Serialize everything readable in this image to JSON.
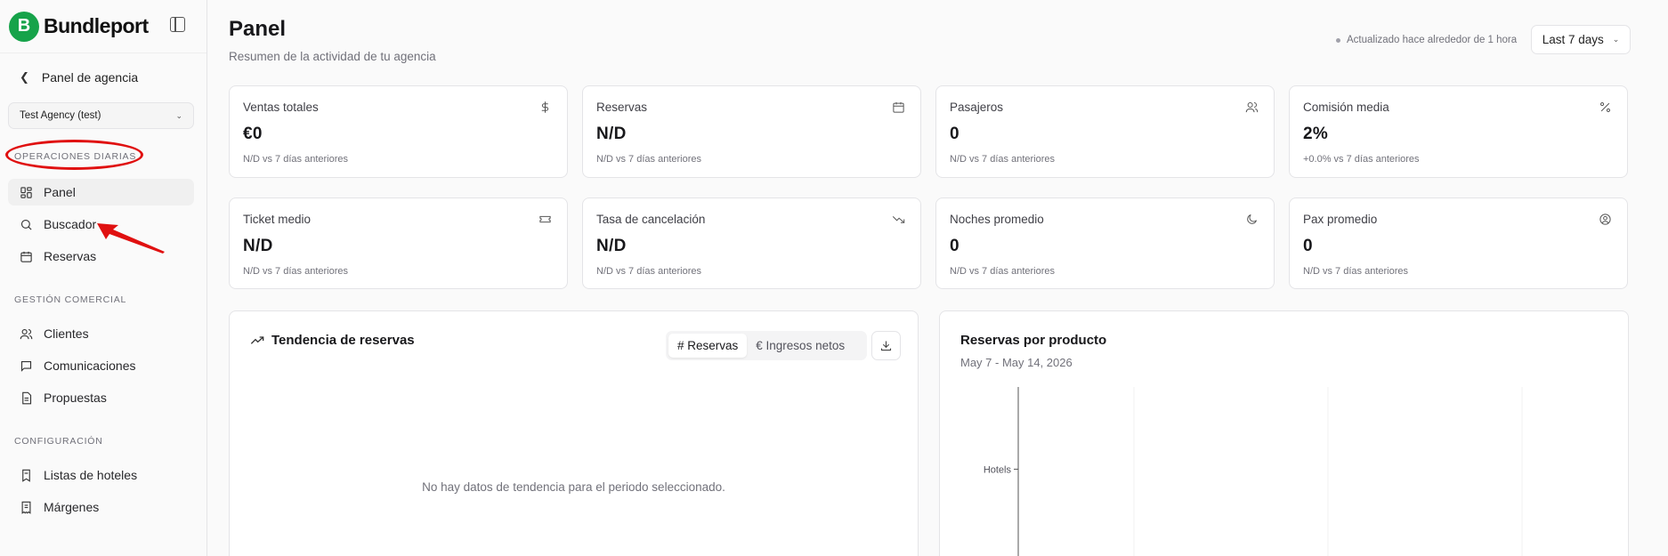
{
  "brand": {
    "name": "Bundleport",
    "mark": "B"
  },
  "sidebar": {
    "back_label": "Panel de agencia",
    "agency_selected": "Test Agency (test)",
    "sections": [
      {
        "title": "OPERACIONES DIARIAS",
        "items": [
          {
            "label": "Panel",
            "icon": "dashboard-icon",
            "active": true
          },
          {
            "label": "Buscador",
            "icon": "search-icon"
          },
          {
            "label": "Reservas",
            "icon": "calendar-icon"
          }
        ]
      },
      {
        "title": "GESTIÓN COMERCIAL",
        "items": [
          {
            "label": "Clientes",
            "icon": "users-icon"
          },
          {
            "label": "Comunicaciones",
            "icon": "message-icon"
          },
          {
            "label": "Propuestas",
            "icon": "document-icon"
          }
        ]
      },
      {
        "title": "CONFIGURACIÓN",
        "items": [
          {
            "label": "Listas de hoteles",
            "icon": "bookmark-list-icon"
          },
          {
            "label": "Márgenes",
            "icon": "receipt-icon"
          }
        ]
      }
    ]
  },
  "header": {
    "title": "Panel",
    "subtitle": "Resumen de la actividad de tu agencia",
    "updated": "Actualizado hace alrededor de 1 hora",
    "range": "Last 7 days"
  },
  "kpis": [
    {
      "label": "Ventas totales",
      "value": "€0",
      "compare": "N/D vs 7 días anteriores",
      "icon": "dollar-icon"
    },
    {
      "label": "Reservas",
      "value": "N/D",
      "compare": "N/D vs 7 días anteriores",
      "icon": "calendar-icon"
    },
    {
      "label": "Pasajeros",
      "value": "0",
      "compare": "N/D vs 7 días anteriores",
      "icon": "users-icon"
    },
    {
      "label": "Comisión media",
      "value": "2%",
      "compare": "+0.0% vs 7 días anteriores",
      "icon": "percent-icon"
    },
    {
      "label": "Ticket medio",
      "value": "N/D",
      "compare": "N/D vs 7 días anteriores",
      "icon": "ticket-icon"
    },
    {
      "label": "Tasa de cancelación",
      "value": "N/D",
      "compare": "N/D vs 7 días anteriores",
      "icon": "trending-down-icon"
    },
    {
      "label": "Noches promedio",
      "value": "0",
      "compare": "N/D vs 7 días anteriores",
      "icon": "moon-icon"
    },
    {
      "label": "Pax promedio",
      "value": "0",
      "compare": "N/D vs 7 días anteriores",
      "icon": "user-circle-icon"
    }
  ],
  "trend": {
    "title": "Tendencia de reservas",
    "toggle": [
      "# Reservas",
      "€ Ingresos netos"
    ],
    "toggle_selected": "# Reservas",
    "empty": "No hay datos de tendencia para el periodo seleccionado."
  },
  "by_product": {
    "title": "Reservas por producto",
    "range": "May 7 - May 14, 2026"
  },
  "chart_data": {
    "type": "bar",
    "title": "Reservas por producto",
    "subtitle": "May 7 - May 14, 2026",
    "categories": [
      "Hotels"
    ],
    "values": [
      0
    ],
    "orientation": "horizontal",
    "grid": true
  },
  "colors": {
    "brand": "#16a34a",
    "annotation": "#e01010"
  }
}
